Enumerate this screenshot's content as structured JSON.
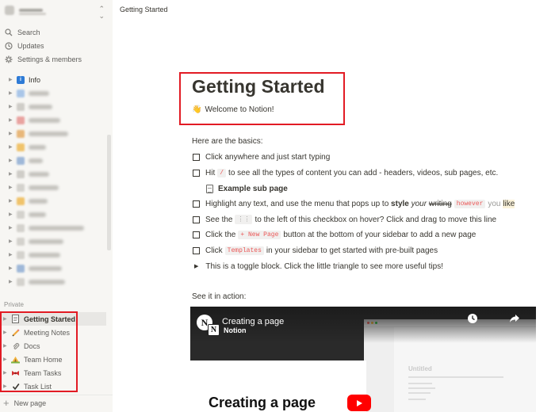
{
  "sidebar": {
    "nav": [
      {
        "label": "Search",
        "icon": "search-icon"
      },
      {
        "label": "Updates",
        "icon": "clock-icon"
      },
      {
        "label": "Settings & members",
        "icon": "gear-icon"
      }
    ],
    "info_label": "Info",
    "private_label": "Private",
    "private_pages": [
      {
        "label": "Getting Started",
        "icon": "page-icon"
      },
      {
        "label": "Meeting Notes",
        "icon": "pencil-icon"
      },
      {
        "label": "Docs",
        "icon": "paperclip-icon"
      },
      {
        "label": "Team Home",
        "icon": "camping-icon"
      },
      {
        "label": "Team Tasks",
        "icon": "bow-icon"
      },
      {
        "label": "Task List",
        "icon": "check-icon"
      }
    ],
    "new_page_label": "New page"
  },
  "topbar": {
    "breadcrumb": "Getting Started"
  },
  "page": {
    "title": "Getting Started",
    "subtitle": "Welcome to Notion!",
    "basics_heading": "Here are the basics:",
    "todos": {
      "t1": "Click anywhere and just start typing",
      "t2_pre": "Hit",
      "t2_code": "/",
      "t2_post": "to see all the types of content you can add - headers, videos, sub pages, etc.",
      "t3_pre": "Highlight any text, and use the menu that pops up to",
      "t3_bold": "style",
      "t3_italic": "your",
      "t3_strike": "writing",
      "t3_code": "however",
      "t3_colored": "you",
      "t3_highlight": "like",
      "t4_pre": "See the",
      "t4_code": "⋮⋮",
      "t4_post": "to the left of this checkbox on hover? Click and drag to move this line",
      "t5_pre": "Click the",
      "t5_code": "+ New Page",
      "t5_post": "button at the bottom of your sidebar to add a new page",
      "t6_pre": "Click",
      "t6_code": "Templates",
      "t6_post": "in your sidebar to get started with pre-built pages"
    },
    "sub_page": "Example sub page",
    "toggle": "This is a toggle block. Click the little triangle to see more useful tips!",
    "see_it": "See it in action:"
  },
  "video": {
    "title": "Creating a page",
    "channel": "Notion",
    "big_title": "Creating a page",
    "panel_title": "Untitled"
  },
  "colors": {
    "annotation_red": "#e21b24",
    "sidebar_bg": "#f7f6f3",
    "code_red": "#eb5757",
    "youtube_red": "#ff0000"
  }
}
